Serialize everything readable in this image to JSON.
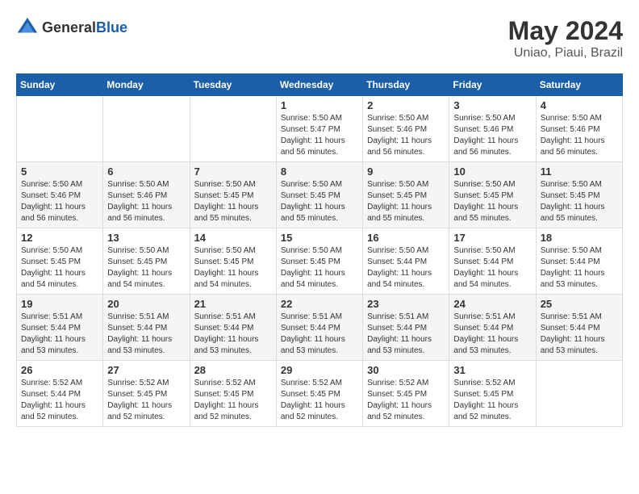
{
  "header": {
    "logo_general": "General",
    "logo_blue": "Blue",
    "month": "May 2024",
    "location": "Uniao, Piaui, Brazil"
  },
  "weekdays": [
    "Sunday",
    "Monday",
    "Tuesday",
    "Wednesday",
    "Thursday",
    "Friday",
    "Saturday"
  ],
  "weeks": [
    [
      {
        "day": "",
        "sunrise": "",
        "sunset": "",
        "daylight": ""
      },
      {
        "day": "",
        "sunrise": "",
        "sunset": "",
        "daylight": ""
      },
      {
        "day": "",
        "sunrise": "",
        "sunset": "",
        "daylight": ""
      },
      {
        "day": "1",
        "sunrise": "Sunrise: 5:50 AM",
        "sunset": "Sunset: 5:47 PM",
        "daylight": "Daylight: 11 hours and 56 minutes."
      },
      {
        "day": "2",
        "sunrise": "Sunrise: 5:50 AM",
        "sunset": "Sunset: 5:46 PM",
        "daylight": "Daylight: 11 hours and 56 minutes."
      },
      {
        "day": "3",
        "sunrise": "Sunrise: 5:50 AM",
        "sunset": "Sunset: 5:46 PM",
        "daylight": "Daylight: 11 hours and 56 minutes."
      },
      {
        "day": "4",
        "sunrise": "Sunrise: 5:50 AM",
        "sunset": "Sunset: 5:46 PM",
        "daylight": "Daylight: 11 hours and 56 minutes."
      }
    ],
    [
      {
        "day": "5",
        "sunrise": "Sunrise: 5:50 AM",
        "sunset": "Sunset: 5:46 PM",
        "daylight": "Daylight: 11 hours and 56 minutes."
      },
      {
        "day": "6",
        "sunrise": "Sunrise: 5:50 AM",
        "sunset": "Sunset: 5:46 PM",
        "daylight": "Daylight: 11 hours and 56 minutes."
      },
      {
        "day": "7",
        "sunrise": "Sunrise: 5:50 AM",
        "sunset": "Sunset: 5:45 PM",
        "daylight": "Daylight: 11 hours and 55 minutes."
      },
      {
        "day": "8",
        "sunrise": "Sunrise: 5:50 AM",
        "sunset": "Sunset: 5:45 PM",
        "daylight": "Daylight: 11 hours and 55 minutes."
      },
      {
        "day": "9",
        "sunrise": "Sunrise: 5:50 AM",
        "sunset": "Sunset: 5:45 PM",
        "daylight": "Daylight: 11 hours and 55 minutes."
      },
      {
        "day": "10",
        "sunrise": "Sunrise: 5:50 AM",
        "sunset": "Sunset: 5:45 PM",
        "daylight": "Daylight: 11 hours and 55 minutes."
      },
      {
        "day": "11",
        "sunrise": "Sunrise: 5:50 AM",
        "sunset": "Sunset: 5:45 PM",
        "daylight": "Daylight: 11 hours and 55 minutes."
      }
    ],
    [
      {
        "day": "12",
        "sunrise": "Sunrise: 5:50 AM",
        "sunset": "Sunset: 5:45 PM",
        "daylight": "Daylight: 11 hours and 54 minutes."
      },
      {
        "day": "13",
        "sunrise": "Sunrise: 5:50 AM",
        "sunset": "Sunset: 5:45 PM",
        "daylight": "Daylight: 11 hours and 54 minutes."
      },
      {
        "day": "14",
        "sunrise": "Sunrise: 5:50 AM",
        "sunset": "Sunset: 5:45 PM",
        "daylight": "Daylight: 11 hours and 54 minutes."
      },
      {
        "day": "15",
        "sunrise": "Sunrise: 5:50 AM",
        "sunset": "Sunset: 5:45 PM",
        "daylight": "Daylight: 11 hours and 54 minutes."
      },
      {
        "day": "16",
        "sunrise": "Sunrise: 5:50 AM",
        "sunset": "Sunset: 5:44 PM",
        "daylight": "Daylight: 11 hours and 54 minutes."
      },
      {
        "day": "17",
        "sunrise": "Sunrise: 5:50 AM",
        "sunset": "Sunset: 5:44 PM",
        "daylight": "Daylight: 11 hours and 54 minutes."
      },
      {
        "day": "18",
        "sunrise": "Sunrise: 5:50 AM",
        "sunset": "Sunset: 5:44 PM",
        "daylight": "Daylight: 11 hours and 53 minutes."
      }
    ],
    [
      {
        "day": "19",
        "sunrise": "Sunrise: 5:51 AM",
        "sunset": "Sunset: 5:44 PM",
        "daylight": "Daylight: 11 hours and 53 minutes."
      },
      {
        "day": "20",
        "sunrise": "Sunrise: 5:51 AM",
        "sunset": "Sunset: 5:44 PM",
        "daylight": "Daylight: 11 hours and 53 minutes."
      },
      {
        "day": "21",
        "sunrise": "Sunrise: 5:51 AM",
        "sunset": "Sunset: 5:44 PM",
        "daylight": "Daylight: 11 hours and 53 minutes."
      },
      {
        "day": "22",
        "sunrise": "Sunrise: 5:51 AM",
        "sunset": "Sunset: 5:44 PM",
        "daylight": "Daylight: 11 hours and 53 minutes."
      },
      {
        "day": "23",
        "sunrise": "Sunrise: 5:51 AM",
        "sunset": "Sunset: 5:44 PM",
        "daylight": "Daylight: 11 hours and 53 minutes."
      },
      {
        "day": "24",
        "sunrise": "Sunrise: 5:51 AM",
        "sunset": "Sunset: 5:44 PM",
        "daylight": "Daylight: 11 hours and 53 minutes."
      },
      {
        "day": "25",
        "sunrise": "Sunrise: 5:51 AM",
        "sunset": "Sunset: 5:44 PM",
        "daylight": "Daylight: 11 hours and 53 minutes."
      }
    ],
    [
      {
        "day": "26",
        "sunrise": "Sunrise: 5:52 AM",
        "sunset": "Sunset: 5:44 PM",
        "daylight": "Daylight: 11 hours and 52 minutes."
      },
      {
        "day": "27",
        "sunrise": "Sunrise: 5:52 AM",
        "sunset": "Sunset: 5:45 PM",
        "daylight": "Daylight: 11 hours and 52 minutes."
      },
      {
        "day": "28",
        "sunrise": "Sunrise: 5:52 AM",
        "sunset": "Sunset: 5:45 PM",
        "daylight": "Daylight: 11 hours and 52 minutes."
      },
      {
        "day": "29",
        "sunrise": "Sunrise: 5:52 AM",
        "sunset": "Sunset: 5:45 PM",
        "daylight": "Daylight: 11 hours and 52 minutes."
      },
      {
        "day": "30",
        "sunrise": "Sunrise: 5:52 AM",
        "sunset": "Sunset: 5:45 PM",
        "daylight": "Daylight: 11 hours and 52 minutes."
      },
      {
        "day": "31",
        "sunrise": "Sunrise: 5:52 AM",
        "sunset": "Sunset: 5:45 PM",
        "daylight": "Daylight: 11 hours and 52 minutes."
      },
      {
        "day": "",
        "sunrise": "",
        "sunset": "",
        "daylight": ""
      }
    ]
  ]
}
